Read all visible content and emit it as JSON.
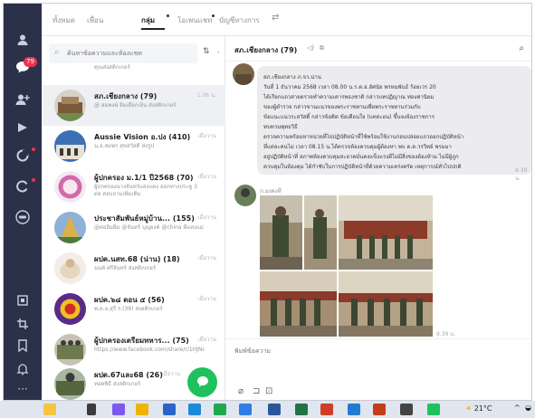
{
  "tabs": [
    {
      "label": "ทั้งหมด",
      "active": false
    },
    {
      "label": "เพื่อน",
      "active": false
    },
    {
      "label": "กลุ่ม",
      "active": true
    },
    {
      "label": "โอเพนแชท",
      "active": false
    },
    {
      "label": "บัญชีทางการ",
      "active": false
    }
  ],
  "rail": {
    "unread_badge": "79"
  },
  "search": {
    "placeholder": "ค้นหาข้อความและห้องแชท"
  },
  "chats": [
    {
      "name": "",
      "preview": "คุณส่งสติกเกอร์",
      "time": "",
      "selected": false
    },
    {
      "name": "สภ.เชียงกลาง (79)",
      "preview": "@ สมพงษ์ ยิ้มเยือกเย็น ส่งสติกเกอร์",
      "time": "1.06 น.",
      "selected": true
    },
    {
      "name": "Aussie Vision อ.ปง (410)",
      "preview": "น.อ.สมพร สุขสวัสดิ์ ส่งรูป",
      "time": "เมื่อวาน",
      "selected": false
    },
    {
      "name": "ผู้ปกครอง ม.1/1 ปี2568 (70)",
      "preview": "ผู้ปกครองนางจันทร์แสงแดง ออกทางประตู 3 ต่อ สอบถามเพิ่มเติม",
      "time": "เมื่อวาน",
      "selected": false
    },
    {
      "name": "ประชาสัมพันธ์หมู่บ้าน... (155)",
      "preview": "@ต่อยิ้มยิ้ม @จันทร์ บุญยงค์ @china พี่แสงแม่",
      "time": "เมื่อวาน",
      "selected": false
    },
    {
      "name": "ผปค.นสท.68 (น่าน) (18)",
      "preview": "นนท์ ศรีจันทร์ ส่งสติกเกอร์",
      "time": "เมื่อวาน",
      "selected": false
    },
    {
      "name": "ผปค.๖๘ ตอน ๕ (56)",
      "preview": "พ.ต.อ.สุรี ร.(39) ส่งสติกเกอร์",
      "time": "เมื่อวาน",
      "selected": false
    },
    {
      "name": "ผู้ปกครองเตรียมทหาร... (75)",
      "preview": "https://www.facebook.com/share/r/1HJNd8a7VW/",
      "time": "เมื่อวาน",
      "selected": false
    },
    {
      "name": "ผปด.67และ68 (26)",
      "preview": "ทอดพิธี ส่งสติกเกอร์",
      "time": "เมื่อวาน",
      "selected": false
    }
  ],
  "chat": {
    "title": "สภ.เชียงกลาง (79)",
    "message_lines": [
      "สภ.เชียงกลาง ภ.จว.น่าน",
      "วันที่ 1 ธันวาคม 2568 เวลา 08.00 น.ร.ต.อ.อัศนัย พรหมพันธ์ ร้อยเวร 20",
      "ได้เรียกแถวสายตรวจทำความเคารพธงชาติ กล่าวบทปฏิญาณ ท่องค่านิยม",
      "ของผู้ตำรวจ กล่าวขานแนวของพระราชทานเพื่อพระราชทานร่วมกับ",
      "ข้อแนะแนวระสวัสดิ์ กล่าวข้อคิด ข้อเตือนใจ (บทสะอน) ขึ้นจงจ้องราชการ",
      "ทบทวนพุทธวิธี",
      "ตรวจความพร้อมหาหน่วยที่ไปปฏิบัติหน้าที่ใช้พร้อมใช้งานก่อนปล่อยแถวออกปฏิบัติหน้า",
      "ที่แต่ละคนไม่ เวลา 08.15 น.ได้ตรวจห้องควบคุมผู้ต้องหา พบ ด.ต.วรวิทย์ พรมมา",
      "อยู่ปฏิบัติหน้าที่ สภาพห้องควบคุมสะอาดมั่นคงแข็งแรงดีไม่มีสิ่งของต้องห้าม ไม่มีผู้ถูก",
      "ควบคุมในห้องคุม ได้กำชับในการปฏิบัติหน้าที่ด้วยความเคร่งครัด เหตุการณ์ทั่วไปปกติ"
    ],
    "message_time": "8.39 น.",
    "sender": "ภ.มงคงที่",
    "photos_time": "8.39 น.",
    "composer_placeholder": "พิมพ์ข้อความ"
  },
  "taskbar": {
    "temperature": "21°C"
  },
  "colors": {
    "rail": "#2b3149",
    "fab": "#1fc15c",
    "badge": "#e9344c",
    "taskbar": "#dfe6ef"
  }
}
